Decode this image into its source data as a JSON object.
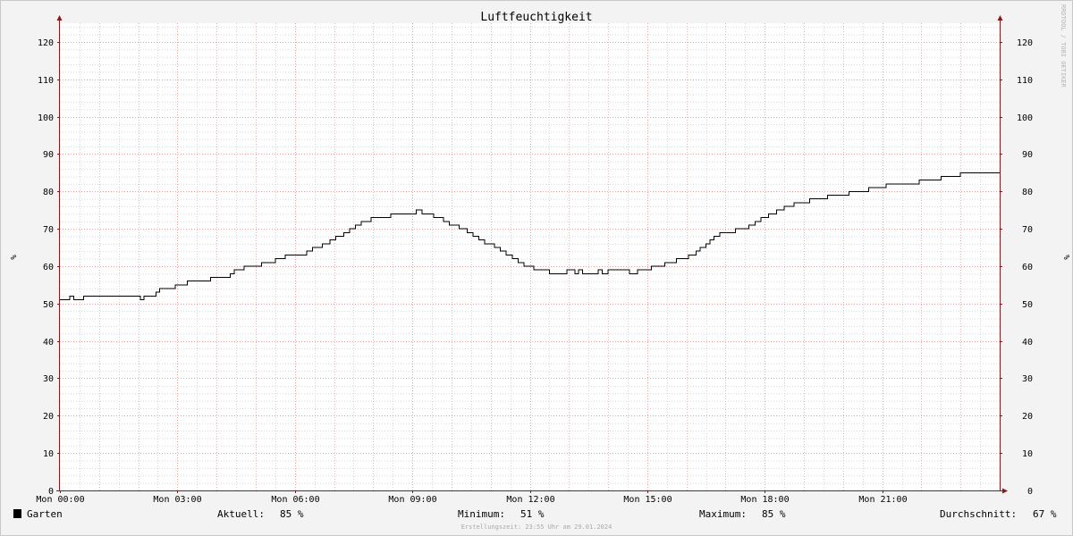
{
  "chart_data": {
    "type": "line",
    "title": "Luftfeuchtigkeit",
    "ylabel": "%",
    "ylabel_right": "%",
    "ylim": [
      0,
      125
    ],
    "yticks": [
      0,
      10,
      20,
      30,
      40,
      50,
      60,
      70,
      80,
      90,
      100,
      110,
      120
    ],
    "xlim": [
      0,
      24
    ],
    "xticks": [
      {
        "x": 0,
        "label": "Mon 00:00"
      },
      {
        "x": 3,
        "label": "Mon 03:00"
      },
      {
        "x": 6,
        "label": "Mon 06:00"
      },
      {
        "x": 9,
        "label": "Mon 09:00"
      },
      {
        "x": 12,
        "label": "Mon 12:00"
      },
      {
        "x": 15,
        "label": "Mon 15:00"
      },
      {
        "x": 18,
        "label": "Mon 18:00"
      },
      {
        "x": 21,
        "label": "Mon 21:00"
      }
    ],
    "grid": true,
    "series": [
      {
        "name": "Garten",
        "color": "#000000",
        "step": true,
        "points": [
          [
            0.0,
            51
          ],
          [
            0.25,
            52
          ],
          [
            0.35,
            51
          ],
          [
            0.6,
            52
          ],
          [
            2.0,
            52
          ],
          [
            2.05,
            51
          ],
          [
            2.15,
            52
          ],
          [
            2.45,
            53
          ],
          [
            2.55,
            54
          ],
          [
            2.95,
            55
          ],
          [
            3.25,
            56
          ],
          [
            3.85,
            57
          ],
          [
            4.35,
            58
          ],
          [
            4.45,
            59
          ],
          [
            4.7,
            60
          ],
          [
            5.15,
            61
          ],
          [
            5.5,
            62
          ],
          [
            5.75,
            63
          ],
          [
            6.3,
            64
          ],
          [
            6.45,
            65
          ],
          [
            6.7,
            66
          ],
          [
            6.9,
            67
          ],
          [
            7.05,
            68
          ],
          [
            7.25,
            69
          ],
          [
            7.4,
            70
          ],
          [
            7.55,
            71
          ],
          [
            7.7,
            72
          ],
          [
            7.95,
            73
          ],
          [
            8.45,
            74
          ],
          [
            9.1,
            75
          ],
          [
            9.25,
            74
          ],
          [
            9.55,
            73
          ],
          [
            9.8,
            72
          ],
          [
            9.95,
            71
          ],
          [
            10.2,
            70
          ],
          [
            10.4,
            69
          ],
          [
            10.55,
            68
          ],
          [
            10.7,
            67
          ],
          [
            10.85,
            66
          ],
          [
            11.1,
            65
          ],
          [
            11.25,
            64
          ],
          [
            11.4,
            63
          ],
          [
            11.55,
            62
          ],
          [
            11.7,
            61
          ],
          [
            11.85,
            60
          ],
          [
            12.1,
            59
          ],
          [
            12.5,
            58
          ],
          [
            12.95,
            59
          ],
          [
            13.15,
            58
          ],
          [
            13.25,
            59
          ],
          [
            13.35,
            58
          ],
          [
            13.75,
            59
          ],
          [
            13.85,
            58
          ],
          [
            14.0,
            59
          ],
          [
            14.55,
            58
          ],
          [
            14.75,
            59
          ],
          [
            15.1,
            60
          ],
          [
            15.45,
            61
          ],
          [
            15.75,
            62
          ],
          [
            16.05,
            63
          ],
          [
            16.25,
            64
          ],
          [
            16.35,
            65
          ],
          [
            16.5,
            66
          ],
          [
            16.6,
            67
          ],
          [
            16.7,
            68
          ],
          [
            16.85,
            69
          ],
          [
            17.25,
            70
          ],
          [
            17.6,
            71
          ],
          [
            17.75,
            72
          ],
          [
            17.9,
            73
          ],
          [
            18.1,
            74
          ],
          [
            18.3,
            75
          ],
          [
            18.5,
            76
          ],
          [
            18.75,
            77
          ],
          [
            19.15,
            78
          ],
          [
            19.6,
            79
          ],
          [
            20.15,
            80
          ],
          [
            20.65,
            81
          ],
          [
            21.1,
            82
          ],
          [
            21.95,
            83
          ],
          [
            22.5,
            84
          ],
          [
            23.0,
            85
          ],
          [
            24.0,
            85
          ]
        ]
      }
    ]
  },
  "legend": {
    "series_name": "Garten",
    "swatch_color": "#000000",
    "current_label": "Aktuell:",
    "current_value": "85 %",
    "min_label": "Minimum:",
    "min_value": "51 %",
    "max_label": "Maximum:",
    "max_value": "85 %",
    "avg_label": "Durchschnitt:",
    "avg_value": "67 %"
  },
  "footer": "Erstellungszeit: 23:55 Uhr am 29.01.2024",
  "watermark": "RRDTOOL / TOBI OETIKER",
  "colors": {
    "background": "#f3f3f3",
    "plot_background": "#ffffff",
    "minor_grid": "#d7d7d7",
    "major_grid": "#f0a0a0",
    "axis": "#8a1a1a",
    "line": "#000000"
  }
}
